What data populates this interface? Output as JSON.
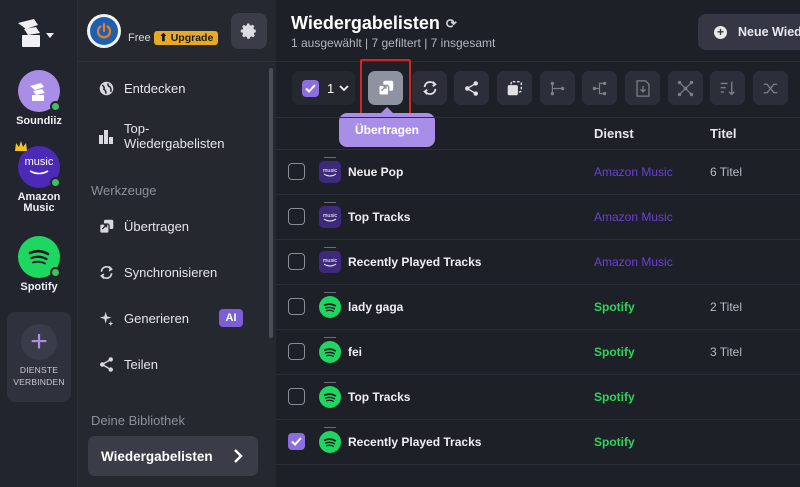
{
  "rail": {
    "services": [
      {
        "label": "Soundiiz",
        "icon": "soundiiz-icon"
      },
      {
        "label": "Amazon Music",
        "icon": "amazon-music-icon",
        "badge_text": "music"
      },
      {
        "label": "Spotify",
        "icon": "spotify-icon"
      }
    ],
    "add": {
      "line1": "DIENSTE",
      "line2": "VERBINDEN"
    }
  },
  "nav": {
    "free_label": "Free",
    "upgrade_label": "Upgrade",
    "items": [
      {
        "label": "Entdecken",
        "icon": "globe-icon"
      },
      {
        "label": "Top-Wiedergabelisten",
        "icon": "bar-chart-icon"
      }
    ],
    "tools_section": "Werkzeuge",
    "tools": [
      {
        "label": "Übertragen",
        "icon": "transfer-icon"
      },
      {
        "label": "Synchronisieren",
        "icon": "sync-icon"
      },
      {
        "label": "Generieren",
        "icon": "sparkle-icon",
        "badge": "AI"
      },
      {
        "label": "Teilen",
        "icon": "share-icon"
      }
    ],
    "library_section": "Deine Bibliothek",
    "active_item": "Wiedergabelisten"
  },
  "main": {
    "title": "Wiedergabelisten",
    "subtitle": "1 ausgewählt | 7 gefiltert | 7 insgesamt",
    "new_button": "Neue Wied",
    "selected_count": "1",
    "tooltip": "Übertragen",
    "columns": {
      "dienst": "Dienst",
      "titel": "Titel"
    },
    "rows": [
      {
        "name": "Neue Pop",
        "service": "Amazon Music",
        "svc": "amz",
        "tracks": "6 Titel",
        "checked": false
      },
      {
        "name": "Top Tracks",
        "service": "Amazon Music",
        "svc": "amz",
        "tracks": "",
        "checked": false
      },
      {
        "name": "Recently Played Tracks",
        "service": "Amazon Music",
        "svc": "amz",
        "tracks": "",
        "checked": false
      },
      {
        "name": "lady gaga",
        "service": "Spotify",
        "svc": "spt",
        "tracks": "2 Titel",
        "checked": false
      },
      {
        "name": "fei",
        "service": "Spotify",
        "svc": "spt",
        "tracks": "3 Titel",
        "checked": false
      },
      {
        "name": "Top Tracks",
        "service": "Spotify",
        "svc": "spt",
        "tracks": "",
        "checked": false
      },
      {
        "name": "Recently Played Tracks",
        "service": "Spotify",
        "svc": "spt",
        "tracks": "",
        "checked": true
      }
    ]
  },
  "colors": {
    "accent": "#8b6fe0",
    "amazon": "#6b3fd9",
    "spotify": "#2fd35a",
    "upgrade": "#e8a923"
  }
}
